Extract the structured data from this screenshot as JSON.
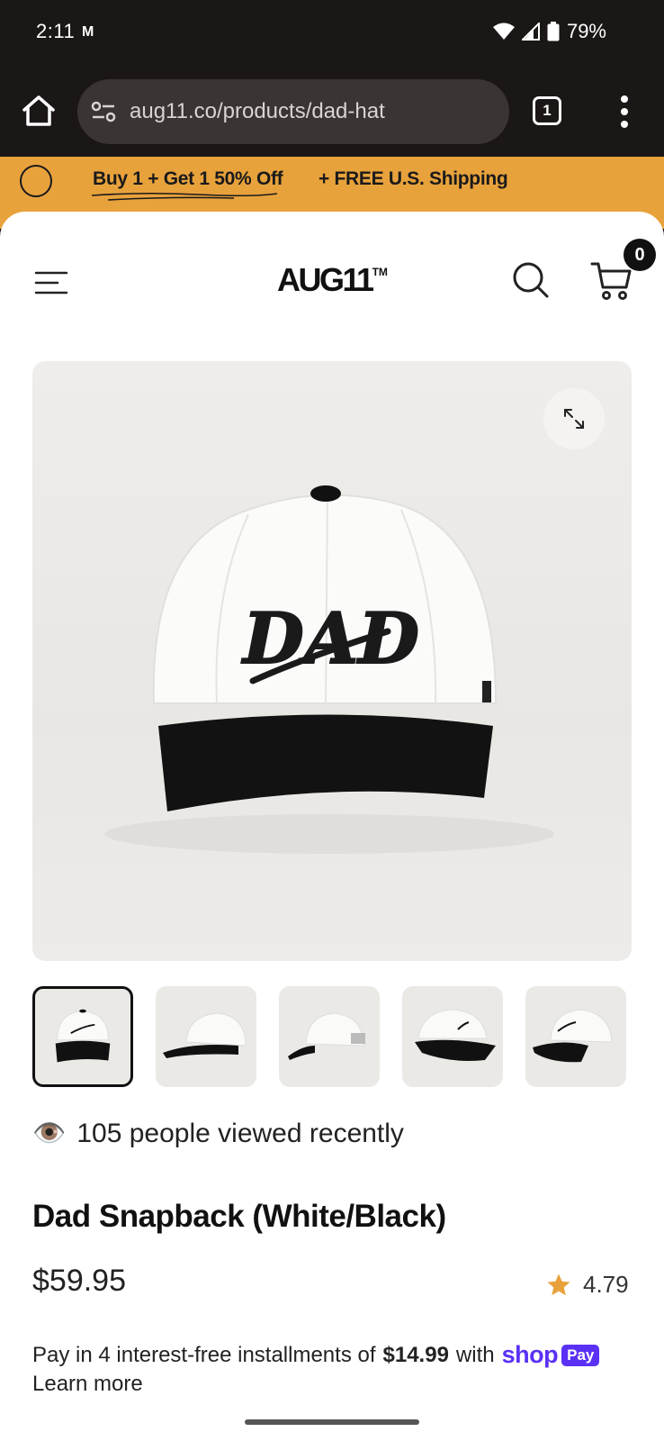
{
  "status_bar": {
    "time": "2:11",
    "carrier_mark": "M",
    "battery": "79%"
  },
  "browser": {
    "url": "aug11.co/products/dad-hat",
    "tab_count": "1"
  },
  "promo": {
    "offer": "Buy 1 + Get 1 50% Off",
    "shipping": "+ FREE U.S. Shipping"
  },
  "header": {
    "logo": "AUG11",
    "logo_mark": "TM",
    "cart_count": "0"
  },
  "hero": {
    "cap_text": "DAD"
  },
  "thumbnails": {
    "count": 5,
    "selected_index": 0
  },
  "product": {
    "viewed_emoji": "👁️",
    "viewed_text": "105 people viewed recently",
    "title": "Dad Snapback (White/Black)",
    "price": "$59.95",
    "rating": "4.79",
    "installments_prefix": "Pay in 4 interest-free installments of",
    "installments_amount": "$14.99",
    "installments_suffix": "with",
    "shop_word": "shop",
    "pay_word": "Pay",
    "learn_more": "Learn more"
  },
  "colors": {
    "promo_bg": "#e8a23c",
    "star": "#e8a23c",
    "shop_pay": "#5a31f4",
    "chrome_bg": "#1b1716"
  }
}
